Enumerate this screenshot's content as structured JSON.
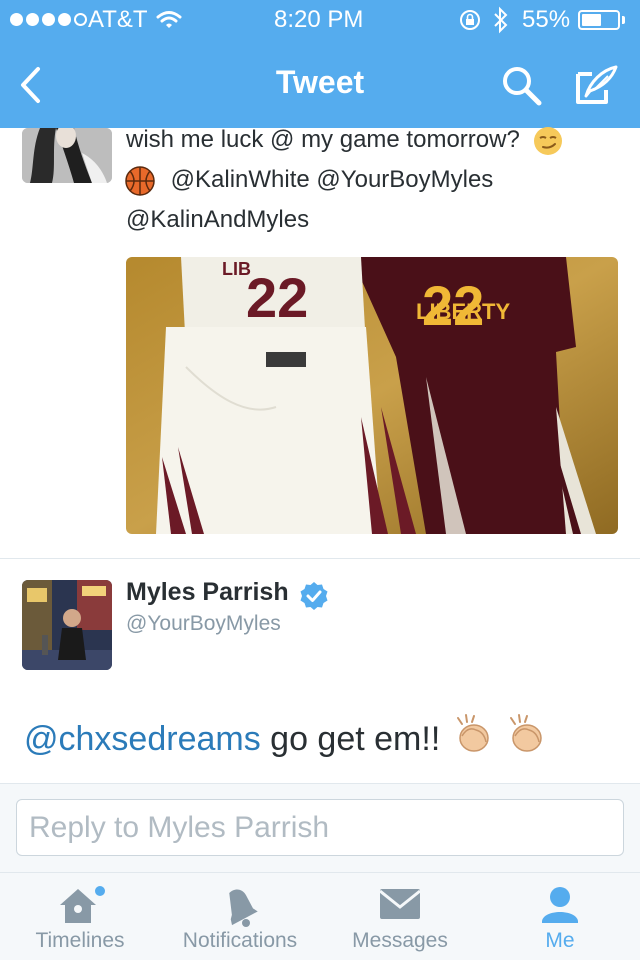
{
  "status_bar": {
    "carrier": "AT&T",
    "time": "8:20 PM",
    "battery": "55%",
    "battery_level": 0.55
  },
  "nav": {
    "title": "Tweet"
  },
  "original_tweet": {
    "text_line1": "wish me luck @ my game tomorrow?",
    "mention_1": "@KalinWhite",
    "mention_2": "@YourBoyMyles",
    "mention_3": "@KalinAndMyles",
    "jersey_number": "22",
    "jersey_letters": "LIBERTY"
  },
  "reply_tweet": {
    "name": "Myles Parrish",
    "handle": "@YourBoyMyles",
    "mention": "@chxsedreams",
    "text": " go get em!!"
  },
  "compose": {
    "placeholder": "Reply to Myles Parrish"
  },
  "tabs": [
    {
      "label": "Timelines",
      "icon": "home-icon"
    },
    {
      "label": "Notifications",
      "icon": "bell-icon"
    },
    {
      "label": "Messages",
      "icon": "envelope-icon"
    },
    {
      "label": "Me",
      "icon": "person-icon"
    }
  ],
  "colors": {
    "header": "#55acee",
    "link": "#2b7bb9",
    "active_tab": "#55acee",
    "inactive_tab": "#8899a6"
  }
}
